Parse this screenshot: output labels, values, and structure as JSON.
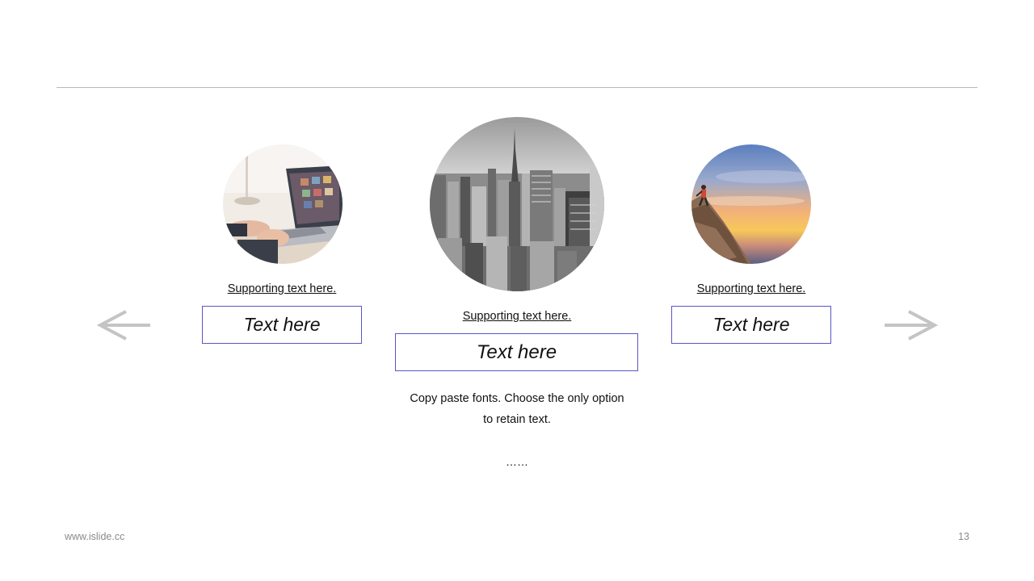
{
  "colors": {
    "rule": "#b8b8b8",
    "box_border": "#5b55c9",
    "arrow": "#c4c4c4",
    "footer_text": "#8a8a8a"
  },
  "navigation": {
    "prev_icon": "arrow-left-icon",
    "next_icon": "arrow-right-icon"
  },
  "cards": {
    "left": {
      "supporting": "Supporting text here.",
      "title": "Text here",
      "image": "laptop-photo"
    },
    "center": {
      "supporting": "Supporting text here.",
      "title": "Text here",
      "image": "city-skyline-photo"
    },
    "right": {
      "supporting": "Supporting text here.",
      "title": "Text here",
      "image": "climber-sunset-photo"
    }
  },
  "body": {
    "line1": "Copy paste fonts. Choose the only option",
    "line2": "to retain text.",
    "ellipsis": "……"
  },
  "footer": {
    "site": "www.islide.cc",
    "page": "13"
  }
}
